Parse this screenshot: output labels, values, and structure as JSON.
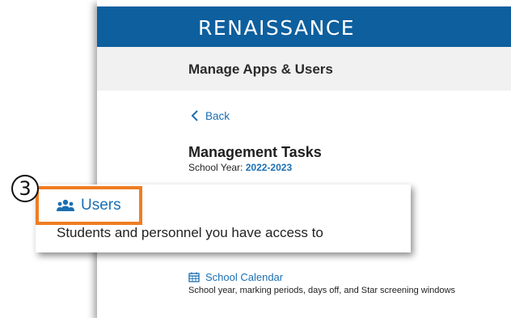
{
  "header": {
    "brand": "RENAISSANCE",
    "brand_color": "#0d5f9e"
  },
  "subheader": {
    "title": "Manage Apps & Users"
  },
  "nav": {
    "back_label": "Back",
    "back_icon": "chevron-left-icon"
  },
  "tasks": {
    "title": "Management Tasks",
    "school_year_label": "School Year:",
    "school_year_value": "2022-2023"
  },
  "callout": {
    "step_number": "3",
    "highlight_color": "#ef7d22",
    "users_icon": "users-group-icon",
    "users_label": "Users",
    "users_description": "Students and personnel you have access to"
  },
  "calendar": {
    "icon": "calendar-icon",
    "label": "School Calendar",
    "description": "School year, marking periods, days off, and Star screening windows"
  },
  "colors": {
    "link": "#1b6fb2",
    "subheader_bg": "#f1f1f1"
  }
}
